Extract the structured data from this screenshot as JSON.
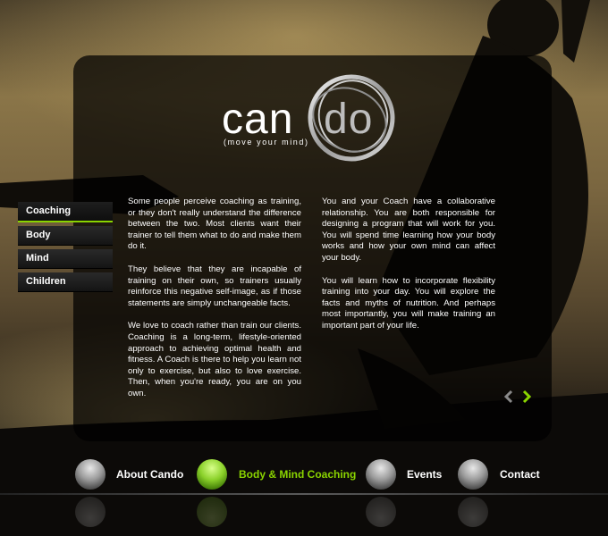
{
  "logo": {
    "word_left": "can",
    "word_right": "do",
    "tagline": "(move your mind)"
  },
  "sidenav": {
    "items": [
      {
        "label": "Coaching",
        "active": true
      },
      {
        "label": "Body",
        "active": false
      },
      {
        "label": "Mind",
        "active": false
      },
      {
        "label": "Children",
        "active": false
      }
    ]
  },
  "content": {
    "left_paragraphs": [
      "Some people perceive coaching as training, or they don't really understand the difference between the two. Most clients want their trainer to tell them what to do and make them do it.",
      "They believe that they are incapable of training on their own, so trainers usually reinforce this negative self-image, as if those statements are simply unchangeable facts.",
      "We love to coach rather than train our clients. Coaching is a long-term, lifestyle-oriented approach to achieving optimal health and fitness. A Coach is there to help you learn not only to exercise, but also to love exercise. Then, when you're ready, you are on you own."
    ],
    "right_paragraphs": [
      "You and your Coach have a collaborative relationship. You are both responsible for designing a program that will work for you. You will spend time learning how your body works and how your own mind can affect your body.",
      "You will learn how to incorporate flexibility training into your day. You will explore the facts and myths of nutrition. And perhaps most importantly, you will make training an important part of your life."
    ]
  },
  "pager": {
    "prev_icon": "chevron-left-icon",
    "next_icon": "chevron-right-icon"
  },
  "main_nav": {
    "items": [
      {
        "label": "About Cando",
        "active": false
      },
      {
        "label": "Body & Mind Coaching",
        "active": true
      },
      {
        "label": "Events",
        "active": false
      },
      {
        "label": "Contact",
        "active": false
      }
    ]
  },
  "colors": {
    "accent": "#8ad400",
    "text": "#ffffff",
    "panel": "#000000"
  }
}
